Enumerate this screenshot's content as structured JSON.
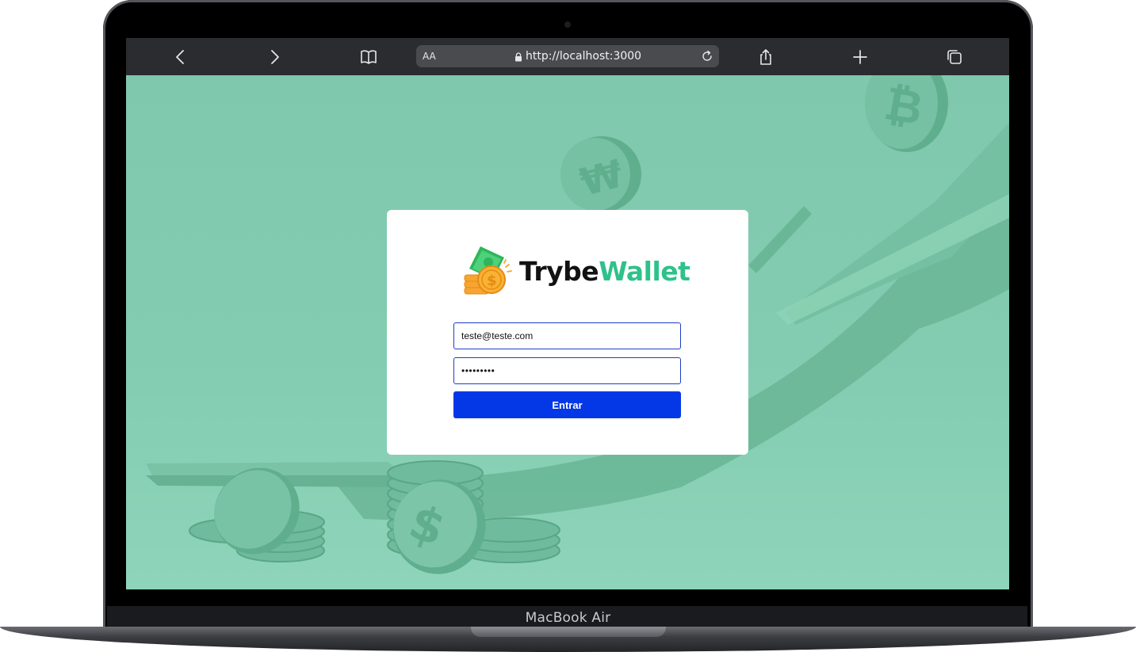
{
  "device": {
    "label": "MacBook Air"
  },
  "browser": {
    "reader_label": "AA",
    "url": "http://localhost:3000",
    "icons": [
      "back-icon",
      "forward-icon",
      "bookmarks-icon",
      "lock-icon",
      "reload-icon",
      "share-icon",
      "new-tab-icon",
      "tabs-icon"
    ]
  },
  "app": {
    "logo": {
      "part1": "Trybe",
      "part2": "Wallet"
    },
    "login": {
      "email_value": "teste@teste.com",
      "password_value": "•••••••••",
      "submit_label": "Entrar"
    }
  },
  "colors": {
    "background": "#7fc8ad",
    "brand_green": "#2fc18c",
    "button": "#0438e6",
    "input_border": "#1d3fc4"
  }
}
